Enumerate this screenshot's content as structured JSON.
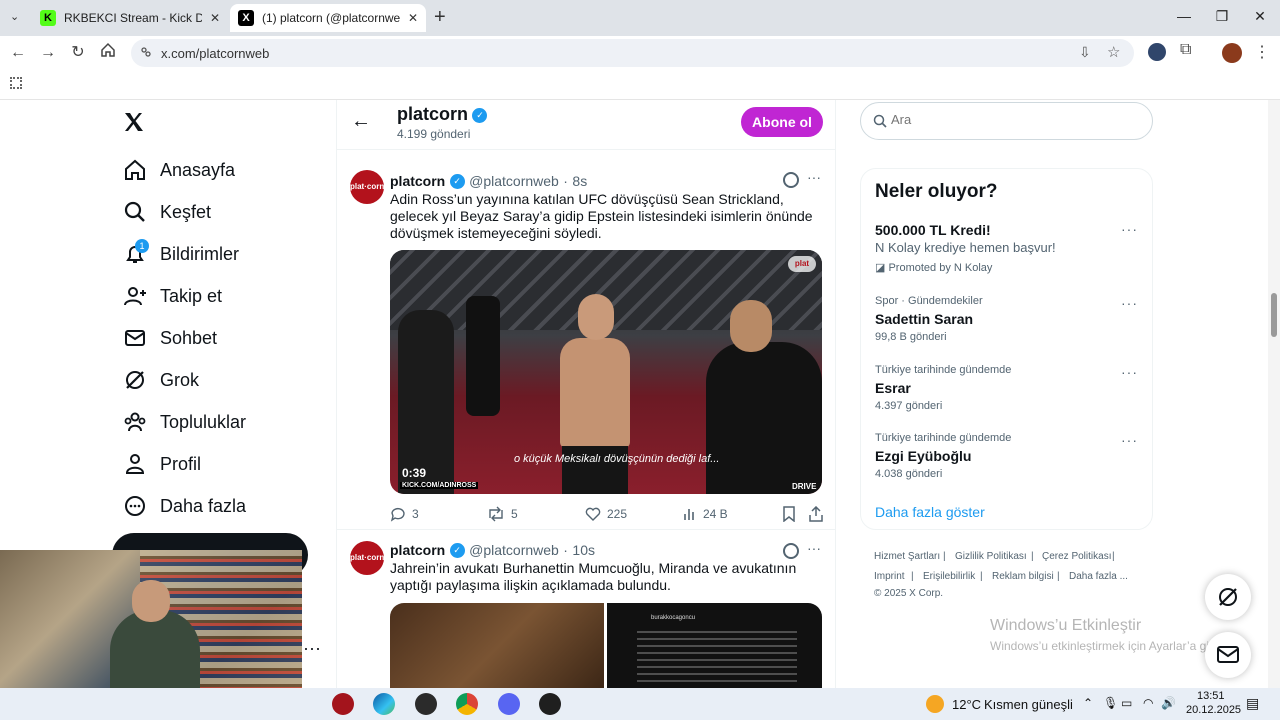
{
  "browser": {
    "tabs": [
      {
        "title": "RKBEKCI Stream - Kick Dashboard",
        "active": false
      },
      {
        "title": "(1) platcorn (@platcornweb) / X",
        "active": true
      }
    ],
    "url": "x.com/platcornweb"
  },
  "nav": {
    "items": [
      {
        "label": "Anasayfa",
        "icon": "home-icon"
      },
      {
        "label": "Keşfet",
        "icon": "search-icon"
      },
      {
        "label": "Bildirimler",
        "icon": "bell-icon"
      },
      {
        "label": "Takip et",
        "icon": "add-user-icon"
      },
      {
        "label": "Sohbet",
        "icon": "mail-icon"
      },
      {
        "label": "Grok",
        "icon": "grok-icon"
      },
      {
        "label": "Topluluklar",
        "icon": "people-icon"
      },
      {
        "label": "Profil",
        "icon": "person-icon"
      },
      {
        "label": "Daha fazla",
        "icon": "more-circle-icon"
      }
    ],
    "notification_count": "1"
  },
  "profile_header": {
    "name": "platcorn",
    "post_count": "4.199 gönderi",
    "subscribe_label": "Abone ol"
  },
  "tweets": [
    {
      "name": "platcorn",
      "handle": "@platcornweb",
      "time": "8s",
      "text": "Adin Ross’un yayınına katılan UFC dövüşçüsü Sean Strickland, gelecek yıl Beyaz Saray’a gidip Epstein listesindeki isimlerin önünde dövüşmek istemeyeceğini söyledi.",
      "video_duration": "0:39",
      "video_caption": "o küçük Meksikalı dövüşçünün dediği laf...",
      "video_watermark": "KICK.COM/ADINROSS",
      "video_brand": "DRIVE",
      "replies": "3",
      "reposts": "5",
      "likes": "225",
      "views": "24 B"
    },
    {
      "name": "platcorn",
      "handle": "@platcornweb",
      "time": "10s",
      "text": "Jahrein’in avukatı Burhanettin Mumcuoğlu, Miranda ve avukatının yaptığı paylaşıma ilişkin açıklamada bulundu.",
      "image_right_user": "burakkocagoncu"
    }
  ],
  "search": {
    "placeholder": "Ara"
  },
  "trends": {
    "title": "Neler oluyor?",
    "items": [
      {
        "context": "",
        "title": "500.000 TL Kredi!",
        "subtitle": "N Kolay krediye hemen başvur!",
        "promoted": "Promoted by N Kolay"
      },
      {
        "context": "Spor · Gündemdekiler",
        "title": "Sadettin Saran",
        "subtitle": "99,8 B gönderi"
      },
      {
        "context": "Türkiye tarihinde gündemde",
        "title": "Esrar",
        "subtitle": "4.397 gönderi"
      },
      {
        "context": "Türkiye tarihinde gündemde",
        "title": "Ezgi Eyüboğlu",
        "subtitle": "4.038 gönderi"
      }
    ],
    "show_more": "Daha fazla göster"
  },
  "footer": {
    "links": [
      "Hizmet Şartları",
      "Gizlilik Politikası",
      "Çerez Politikası",
      "Imprint",
      "Erişilebilirlik",
      "Reklam bilgisi",
      "Daha fazla ..."
    ],
    "copyright": "© 2025 X Corp."
  },
  "watermark": {
    "line1": "Windows’u Etkinleştir",
    "line2": "Windows’u etkinleştirmek için Ayarlar’a gidin."
  },
  "taskbar": {
    "weather": "12°C",
    "weather_desc": "Kısmen güneşli",
    "time": "13:51",
    "date": "20.12.2025"
  },
  "colors": {
    "accent": "#1d9bf0",
    "subscribe": "#c026d3",
    "text": "#0f1419",
    "muted": "#536471"
  }
}
